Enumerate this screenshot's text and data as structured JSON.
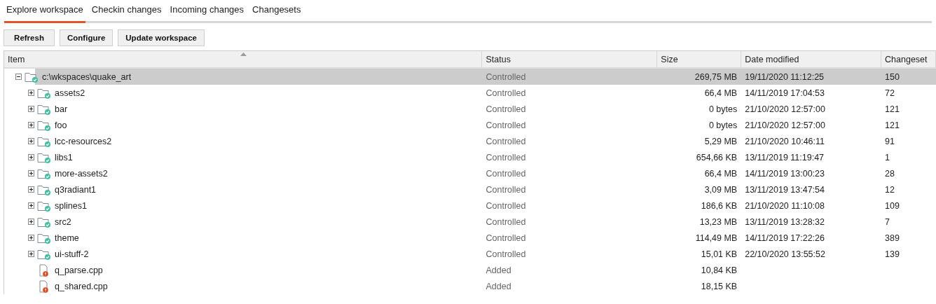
{
  "tabs": [
    {
      "label": "Explore workspace",
      "selected": true
    },
    {
      "label": "Checkin changes",
      "selected": false
    },
    {
      "label": "Incoming changes",
      "selected": false
    },
    {
      "label": "Changesets",
      "selected": false
    }
  ],
  "toolbar": {
    "buttons": [
      "Refresh",
      "Configure",
      "Update workspace"
    ]
  },
  "table": {
    "columns": [
      {
        "label": "Item",
        "sorted": true
      },
      {
        "label": "Status",
        "sorted": false
      },
      {
        "label": "Size",
        "sorted": false
      },
      {
        "label": "Date modified",
        "sorted": false
      },
      {
        "label": "Changeset",
        "sorted": false
      }
    ],
    "rows": [
      {
        "kind": "folder",
        "name": "c:\\wkspaces\\quake_art",
        "status": "Controlled",
        "size": "269,75 MB",
        "date": "19/11/2020 11:12:25",
        "changeset": "150",
        "expanded": true,
        "selected": true,
        "children": [
          {
            "kind": "folder",
            "name": "assets2",
            "status": "Controlled",
            "size": "66,4 MB",
            "date": "14/11/2019 17:04:53",
            "changeset": "72",
            "expanded": false,
            "selected": false
          },
          {
            "kind": "folder",
            "name": "bar",
            "status": "Controlled",
            "size": "0 bytes",
            "date": "21/10/2020 12:57:00",
            "changeset": "121",
            "expanded": false,
            "selected": false
          },
          {
            "kind": "folder",
            "name": "foo",
            "status": "Controlled",
            "size": "0 bytes",
            "date": "21/10/2020 12:57:00",
            "changeset": "121",
            "expanded": false,
            "selected": false
          },
          {
            "kind": "folder",
            "name": "lcc-resources2",
            "status": "Controlled",
            "size": "5,29 MB",
            "date": "21/10/2020 10:46:11",
            "changeset": "91",
            "expanded": false,
            "selected": false
          },
          {
            "kind": "folder",
            "name": "libs1",
            "status": "Controlled",
            "size": "654,66 KB",
            "date": "13/11/2019 11:19:47",
            "changeset": "1",
            "expanded": false,
            "selected": false
          },
          {
            "kind": "folder",
            "name": "more-assets2",
            "status": "Controlled",
            "size": "66,4 MB",
            "date": "14/11/2019 13:00:23",
            "changeset": "28",
            "expanded": false,
            "selected": false
          },
          {
            "kind": "folder",
            "name": "q3radiant1",
            "status": "Controlled",
            "size": "3,09 MB",
            "date": "13/11/2019 13:47:54",
            "changeset": "12",
            "expanded": false,
            "selected": false
          },
          {
            "kind": "folder",
            "name": "splines1",
            "status": "Controlled",
            "size": "186,6 KB",
            "date": "21/10/2020 11:10:08",
            "changeset": "109",
            "expanded": false,
            "selected": false
          },
          {
            "kind": "folder",
            "name": "src2",
            "status": "Controlled",
            "size": "13,23 MB",
            "date": "13/11/2019 13:28:32",
            "changeset": "7",
            "expanded": false,
            "selected": false
          },
          {
            "kind": "folder",
            "name": "theme",
            "status": "Controlled",
            "size": "114,49 MB",
            "date": "14/11/2019 17:22:26",
            "changeset": "389",
            "expanded": false,
            "selected": false
          },
          {
            "kind": "folder",
            "name": "ui-stuff-2",
            "status": "Controlled",
            "size": "15,01 KB",
            "date": "22/10/2020 13:55:52",
            "changeset": "139",
            "expanded": false,
            "selected": false
          },
          {
            "kind": "file",
            "name": "q_parse.cpp",
            "status": "Added",
            "size": "10,84 KB",
            "selected": false
          },
          {
            "kind": "file",
            "name": "q_shared.cpp",
            "status": "Added",
            "size": "18,15 KB",
            "selected": false
          }
        ]
      }
    ]
  }
}
